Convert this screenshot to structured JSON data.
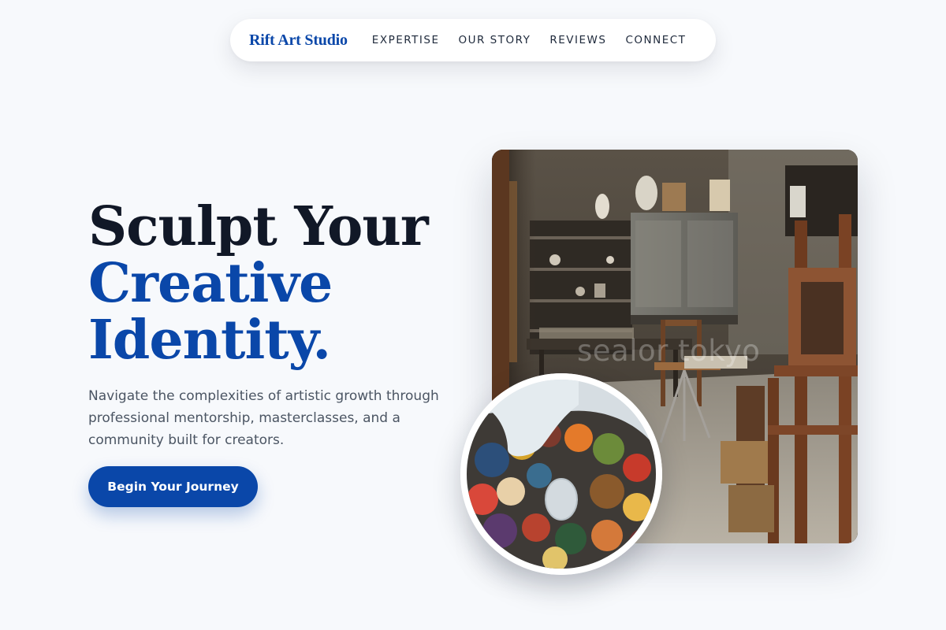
{
  "nav": {
    "brand": "Rift Art Studio",
    "links": [
      "EXPERTISE",
      "OUR STORY",
      "REVIEWS",
      "CONNECT"
    ]
  },
  "hero": {
    "headline_line1": "Sculpt Your",
    "headline_line2": "Creative",
    "headline_line3": "Identity.",
    "subcopy": "Navigate the complexities of artistic growth through professional mentorship, masterclasses, and a community built for creators.",
    "cta_label": "Begin Your Journey"
  },
  "images": {
    "studio_photo": "art-studio-interior-photo",
    "studio_watermark": "sealor tokyo",
    "palette_photo": "paint-palette-photo"
  },
  "colors": {
    "accent": "#0a47a9",
    "heading": "#111827",
    "body_text": "#4b5563",
    "background": "#f7f9fc"
  }
}
